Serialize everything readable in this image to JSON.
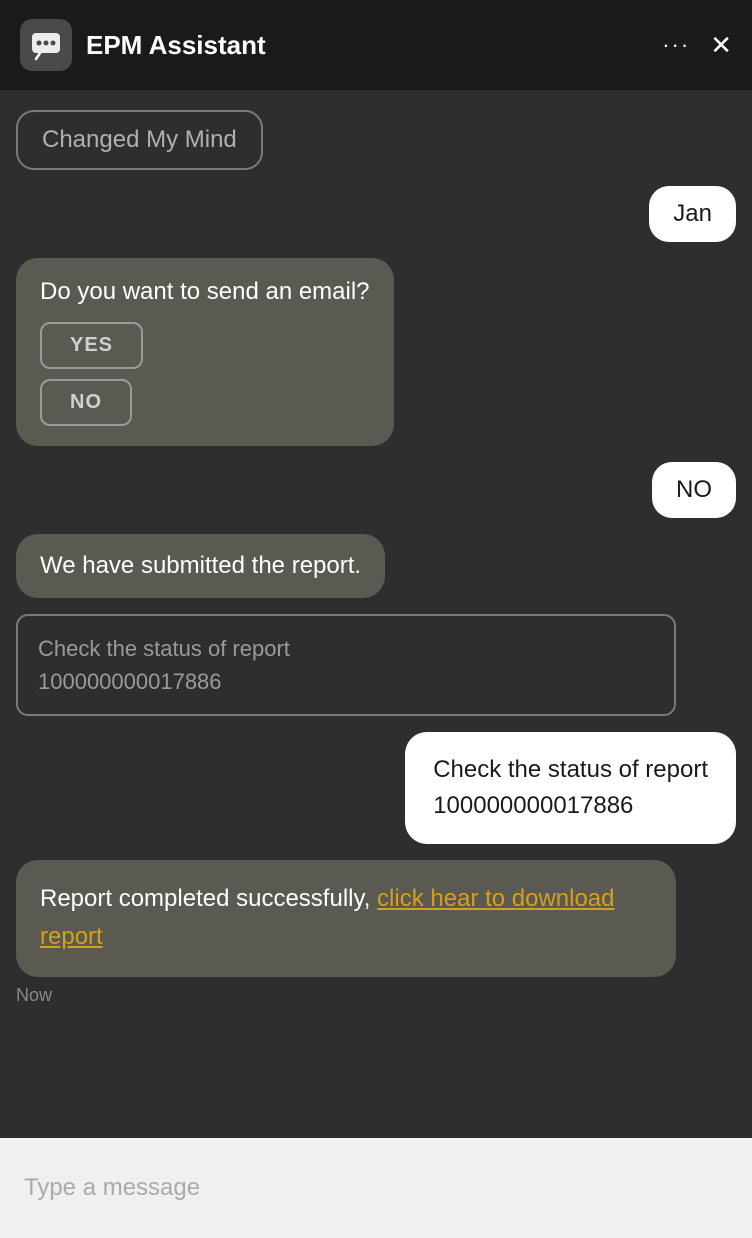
{
  "header": {
    "title": "EPM Assistant",
    "dots_label": "···",
    "close_label": "✕",
    "icon_alt": "chat-icon"
  },
  "chat": {
    "changed_mind_label": "Changed My Mind",
    "jan_label": "Jan",
    "email_question": "Do you want to send an email?",
    "yes_label": "YES",
    "no_label": "NO",
    "no_response_label": "NO",
    "submitted_label": "We have submitted the report.",
    "check_status_placeholder": "Check the status of report\n100000000017886",
    "check_status_white": "Check the status of report 100000000017886",
    "report_prefix": "Report completed successfully, ",
    "report_link": "click hear to download report",
    "timestamp": "Now"
  },
  "input": {
    "placeholder": "Type a message"
  }
}
